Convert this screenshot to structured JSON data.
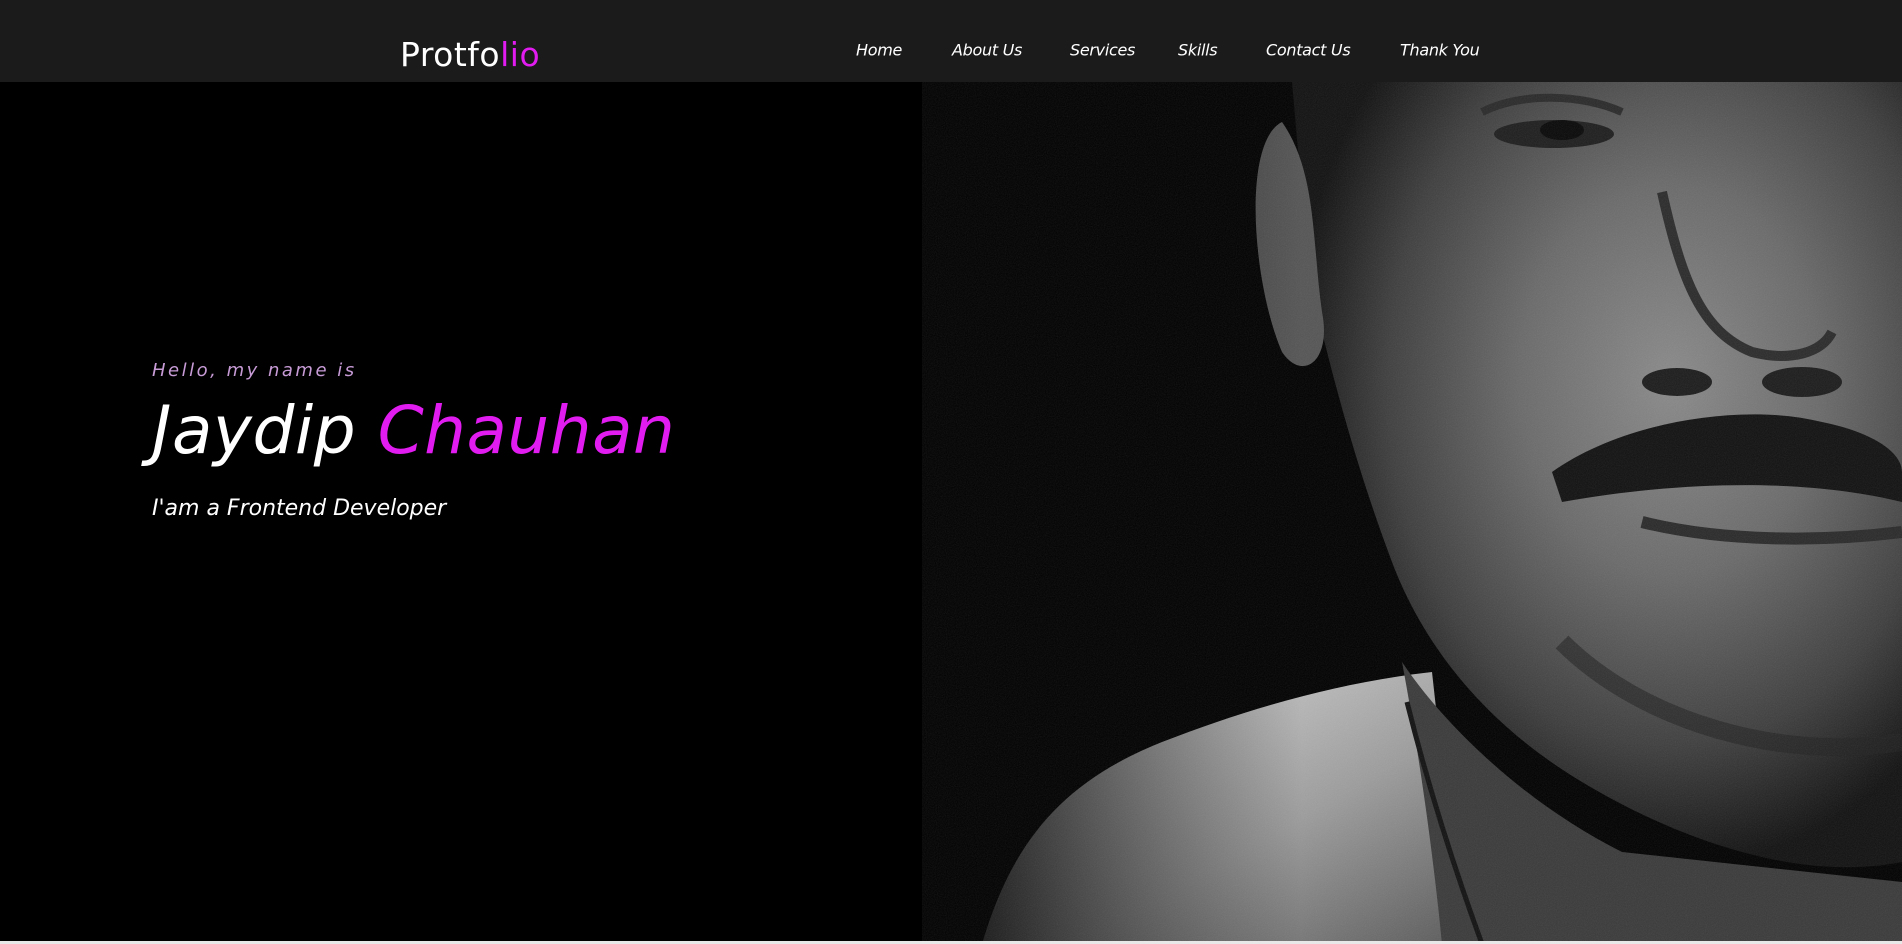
{
  "brand": {
    "logo_main": "Protfo",
    "logo_accent": "lio",
    "accent_color": "#e11cf0"
  },
  "nav": {
    "items": [
      {
        "label": "Home"
      },
      {
        "label": "About Us"
      },
      {
        "label": "Services"
      },
      {
        "label": "Skills"
      },
      {
        "label": "Contact Us"
      },
      {
        "label": "Thank You"
      }
    ]
  },
  "hero": {
    "greeting": "Hello, my name is",
    "first_name": "Jaydip",
    "last_name": "Chauhan",
    "role": "I'am a Frontend Developer",
    "photo_icon": "portrait-photo"
  }
}
